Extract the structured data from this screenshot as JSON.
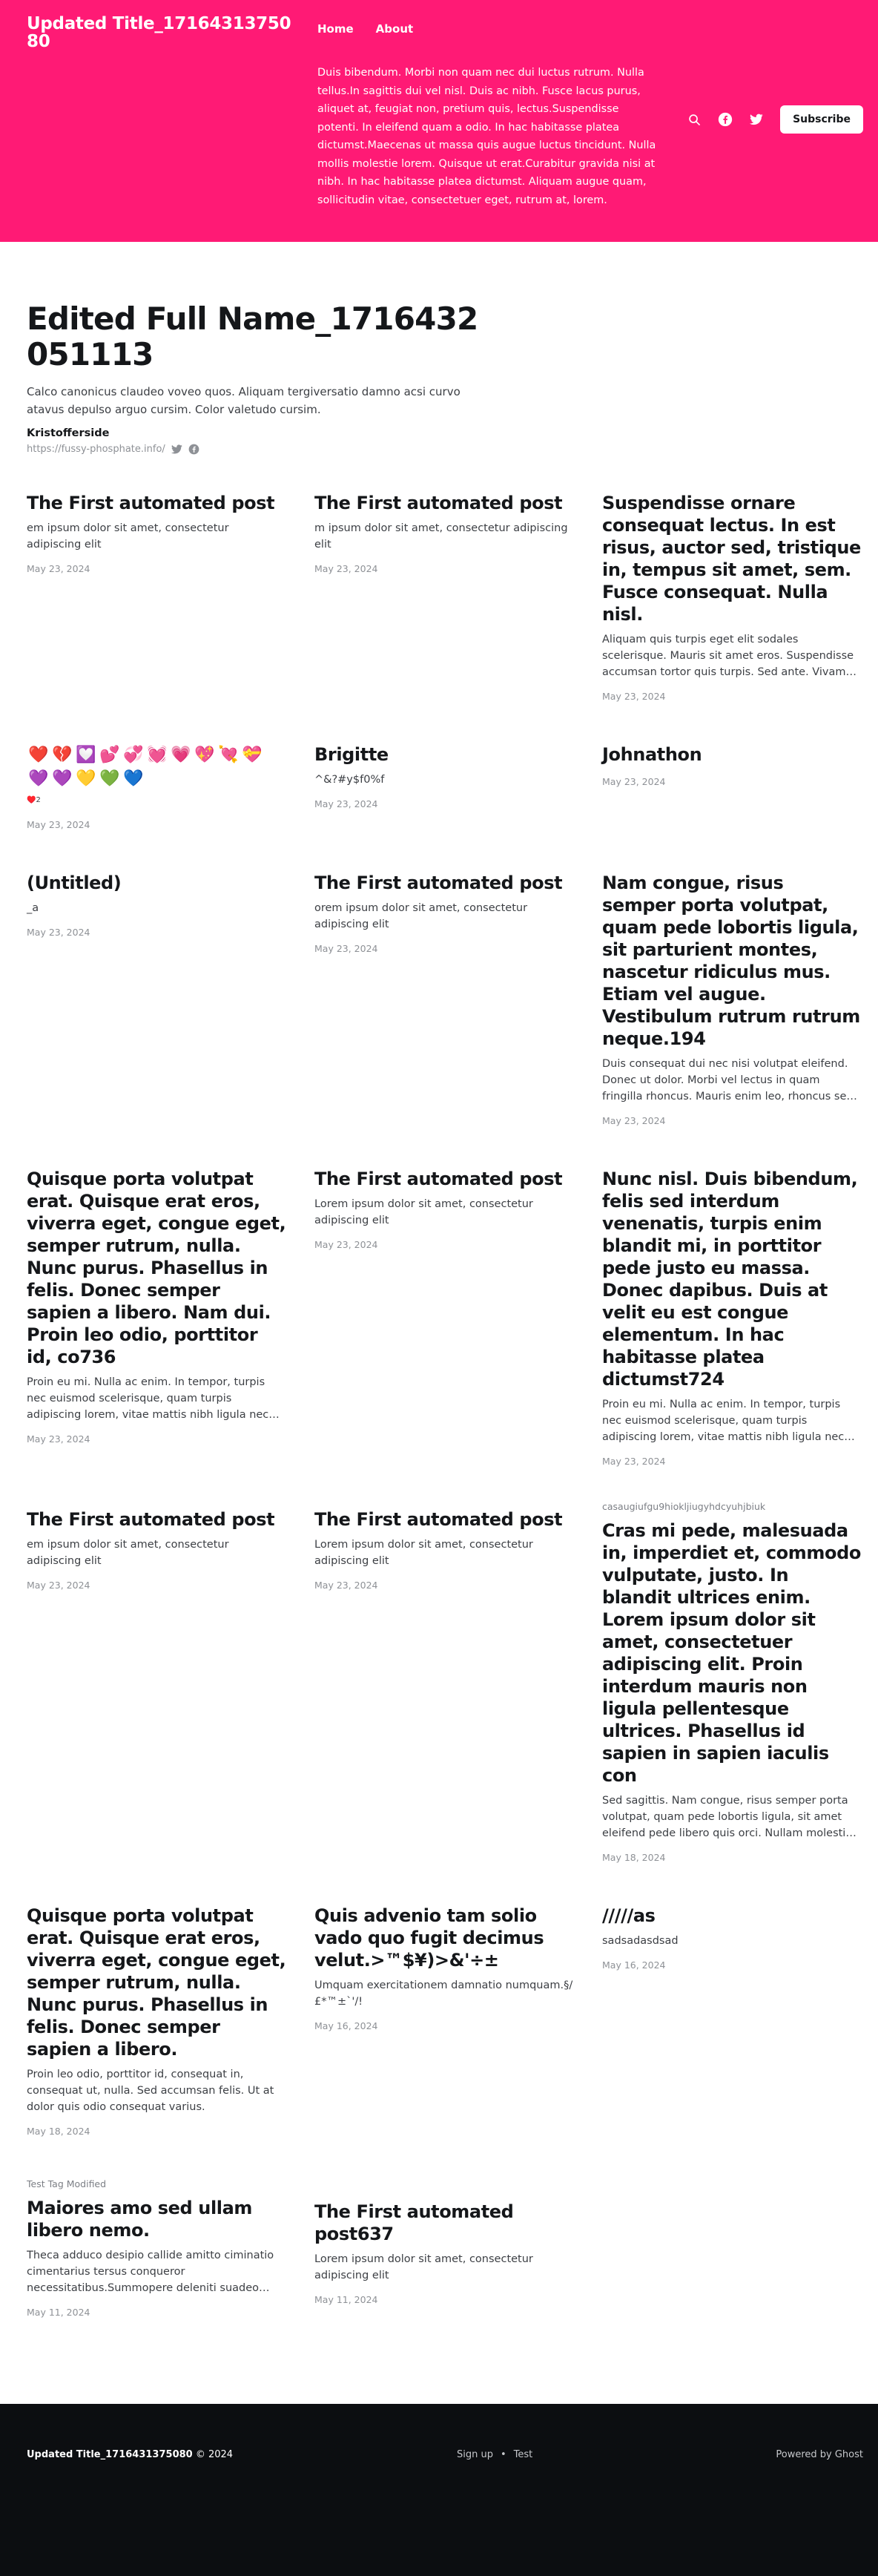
{
  "header": {
    "site_title": "Updated Title_1716431375080",
    "nav": [
      "Home",
      "About"
    ],
    "description": "Duis bibendum. Morbi non quam nec dui luctus rutrum. Nulla tellus.In sagittis dui vel nisl. Duis ac nibh. Fusce lacus purus, aliquet at, feugiat non, pretium quis, lectus.Suspendisse potenti. In eleifend quam a odio. In hac habitasse platea dictumst.Maecenas ut massa quis augue luctus tincidunt. Nulla mollis molestie lorem. Quisque ut erat.Curabitur gravida nisi at nibh. In hac habitasse platea dictumst. Aliquam augue quam, sollicitudin vitae, consectetuer eget, rutrum at, lorem.",
    "subscribe_label": "Subscribe",
    "accent_color": "#ff1a75"
  },
  "author": {
    "name": "Edited Full Name_1716432051113",
    "bio": "Calco canonicus claudeo voveo quos. Aliquam tergiversatio damno acsi curvo atavus depulso arguo cursim. Color valetudo cursim.",
    "location": "Kristofferside",
    "website": "https://fussy-phosphate.info/"
  },
  "posts": [
    {
      "tag": "",
      "title": "The First automated post",
      "excerpt": "em ipsum dolor sit amet, consectetur adipiscing elit",
      "date": "May 23, 2024"
    },
    {
      "tag": "",
      "title": "The First automated post",
      "excerpt": "m ipsum dolor sit amet, consectetur adipiscing elit",
      "date": "May 23, 2024"
    },
    {
      "tag": "",
      "title": "Suspendisse ornare consequat lectus. In est risus, auctor sed, tristique in, tempus sit amet, sem. Fusce consequat. Nulla nisl.",
      "excerpt": "Aliquam quis turpis eget elit sodales scelerisque. Mauris sit amet eros. Suspendisse accumsan tortor quis turpis. Sed ante. Vivamus tortor. Duis mattis egestas metus.",
      "date": "May 23, 2024"
    },
    {
      "tag": "",
      "title": "",
      "excerpt": "♥️2",
      "date": "May 23, 2024",
      "emojis": [
        "❤️",
        "💔",
        "💟",
        "💕",
        "💞",
        "💓",
        "💗",
        "💖",
        "💘",
        "💝",
        "💜",
        "💜",
        "💛",
        "💚",
        "💙"
      ]
    },
    {
      "tag": "",
      "title": "Brigitte",
      "excerpt": "^&?#y$f0%f",
      "date": "May 23, 2024"
    },
    {
      "tag": "",
      "title": "Johnathon",
      "excerpt": "",
      "date": "May 23, 2024"
    },
    {
      "tag": "",
      "title": "(Untitled)",
      "excerpt": "_a",
      "date": "May 23, 2024"
    },
    {
      "tag": "",
      "title": "The First automated post",
      "excerpt": "orem ipsum dolor sit amet, consectetur adipiscing elit",
      "date": "May 23, 2024"
    },
    {
      "tag": "",
      "title": "Nam congue, risus semper porta volutpat, quam pede lobortis ligula, sit parturient montes, nascetur ridiculus mus. Etiam vel augue. Vestibulum rutrum rutrum neque.194",
      "excerpt": "Duis consequat dui nec nisi volutpat eleifend. Donec ut dolor. Morbi vel lectus in quam fringilla rhoncus. Mauris enim leo, rhoncus sed, vestibulum sit amet.",
      "date": "May 23, 2024"
    },
    {
      "tag": "",
      "title": "Quisque porta volutpat erat. Quisque erat eros, viverra eget, congue eget, semper rutrum, nulla. Nunc purus. Phasellus in felis. Donec semper sapien a libero. Nam dui. Proin leo odio, porttitor id, co736",
      "excerpt": "Proin eu mi. Nulla ac enim. In tempor, turpis nec euismod scelerisque, quam turpis adipiscing lorem, vitae mattis nibh ligula nec sem. Duis aliquam convallis nunc.",
      "date": "May 23, 2024"
    },
    {
      "tag": "",
      "title": "The First automated post",
      "excerpt": "Lorem ipsum dolor sit amet, consectetur adipiscing elit",
      "date": "May 23, 2024"
    },
    {
      "tag": "",
      "title": "Nunc nisl. Duis bibendum, felis sed interdum venenatis, turpis enim blandit mi, in porttitor pede justo eu massa. Donec dapibus. Duis at velit eu est congue elementum. In hac habitasse platea dictumst724",
      "excerpt": "Proin eu mi. Nulla ac enim. In tempor, turpis nec euismod scelerisque, quam turpis adipiscing lorem, vitae mattis nibh ligula nec sem. Duis aliquam convallis nunc.",
      "date": "May 23, 2024"
    },
    {
      "tag": "",
      "title": "The First automated post",
      "excerpt": "em ipsum dolor sit amet, consectetur adipiscing elit",
      "date": "May 23, 2024"
    },
    {
      "tag": "",
      "title": "The First automated post",
      "excerpt": "Lorem ipsum dolor sit amet, consectetur adipiscing elit",
      "date": "May 23, 2024"
    },
    {
      "tag": "casaugiufgu9hiokljiugyhdcyuhjbiuk",
      "title": "Cras mi pede, malesuada in, imperdiet et, commodo vulputate, justo. In blandit ultrices enim. Lorem ipsum dolor sit amet, consectetuer adipiscing elit. Proin interdum mauris non ligula pellentesque ultrices. Phasellus id sapien in sapien iaculis con",
      "excerpt": "Sed sagittis. Nam congue, risus semper porta volutpat, quam pede lobortis ligula, sit amet eleifend pede libero quis orci. Nullam molestie nibh in lectus.",
      "date": "May 18, 2024"
    },
    {
      "tag": "",
      "title": "Quisque porta volutpat erat. Quisque erat eros, viverra eget, congue eget, semper rutrum, nulla. Nunc purus. Phasellus in felis. Donec semper sapien a libero.",
      "excerpt": "Proin leo odio, porttitor id, consequat in, consequat ut, nulla. Sed accumsan felis. Ut at dolor quis odio consequat varius.",
      "date": "May 18, 2024"
    },
    {
      "tag": "",
      "title": "Quis advenio tam solio vado quo fugit decimus velut.>™$¥)>&'÷±",
      "excerpt": "Umquam exercitationem damnatio numquam.§/£*™±`'/!",
      "date": "May 16, 2024"
    },
    {
      "tag": "",
      "title": "/////as",
      "excerpt": "sadsadasdsad",
      "date": "May 16, 2024"
    },
    {
      "tag": "Test Tag Modified",
      "title": "Maiores amo sed ullam libero nemo.",
      "excerpt": "Theca adduco desipio callide amitto ciminatio cimentarius tersus conqueror necessitatibus.Summopere deleniti suadeo clarus.",
      "date": "May 11, 2024"
    },
    {
      "tag": "",
      "title": "The First automated post637",
      "excerpt": "Lorem ipsum dolor sit amet, consectetur adipiscing elit",
      "date": "May 11, 2024"
    }
  ],
  "footer": {
    "site_title": "Updated Title_1716431375080",
    "copyright": "© 2024",
    "links": [
      "Sign up",
      "Test"
    ],
    "separator": "•",
    "powered": "Powered by Ghost"
  }
}
